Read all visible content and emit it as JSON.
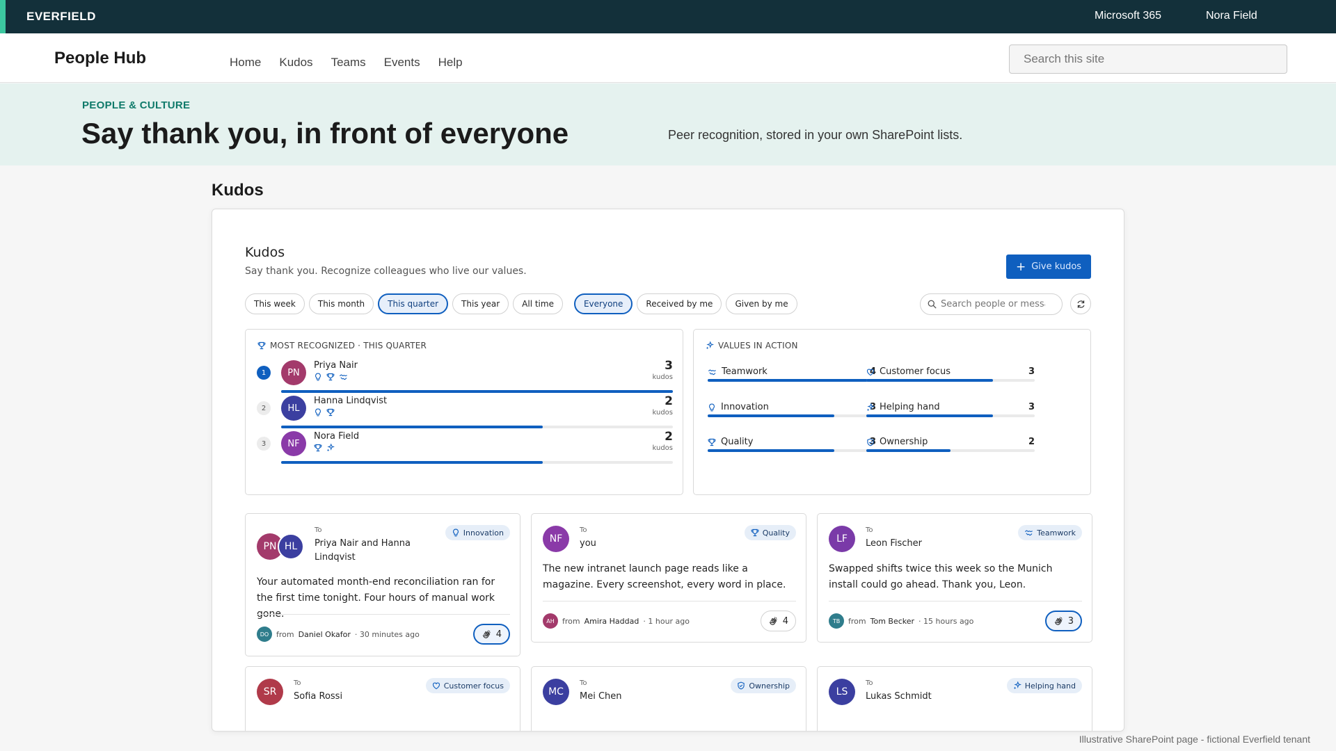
{
  "suitebar": {
    "brand": "EVERFIELD",
    "app": "Microsoft 365",
    "user": "Nora Field"
  },
  "site": {
    "title": "People Hub",
    "nav": [
      "Home",
      "Kudos",
      "Teams",
      "Events",
      "Help"
    ],
    "search_placeholder": "Search this site"
  },
  "hero": {
    "eyebrow": "PEOPLE & CULTURE",
    "headline": "Say thank you, in front of everyone",
    "subtitle": "Peer recognition, stored in your own SharePoint lists."
  },
  "section_title": "Kudos",
  "webpart": {
    "title": "Kudos",
    "subtitle": "Say thank you. Recognize colleagues who live our values.",
    "give_button": "Give kudos",
    "time_filters": [
      {
        "label": "This week",
        "active": false
      },
      {
        "label": "This month",
        "active": false
      },
      {
        "label": "This quarter",
        "active": true
      },
      {
        "label": "This year",
        "active": false
      },
      {
        "label": "All time",
        "active": false
      }
    ],
    "scope_filters": [
      {
        "label": "Everyone",
        "active": true
      },
      {
        "label": "Received by me",
        "active": false
      },
      {
        "label": "Given by me",
        "active": false
      }
    ],
    "search_placeholder": "Search people or messages",
    "leaderboard": {
      "heading": "MOST RECOGNIZED · THIS QUARTER",
      "unit": "kudos",
      "entries": [
        {
          "rank": "1",
          "initials": "PN",
          "name": "Priya Nair",
          "count": 3,
          "share": 1.0,
          "color": "#a33a6b",
          "icons": [
            "bulb-icon",
            "trophy-icon",
            "handshake-icon"
          ]
        },
        {
          "rank": "2",
          "initials": "HL",
          "name": "Hanna Lindqvist",
          "count": 2,
          "share": 0.667,
          "color": "#3b3fa0",
          "icons": [
            "bulb-icon",
            "trophy-icon"
          ]
        },
        {
          "rank": "3",
          "initials": "NF",
          "name": "Nora Field",
          "count": 2,
          "share": 0.667,
          "color": "#8a3aa8",
          "icons": [
            "trophy-icon",
            "sparkle-icon"
          ]
        }
      ]
    },
    "values": {
      "heading": "VALUES IN ACTION",
      "items": [
        {
          "label": "Teamwork",
          "count": 4,
          "share": 1.0,
          "icon": "handshake-icon"
        },
        {
          "label": "Customer focus",
          "count": 3,
          "share": 0.75,
          "icon": "heart-icon"
        },
        {
          "label": "Innovation",
          "count": 3,
          "share": 0.75,
          "icon": "bulb-icon"
        },
        {
          "label": "Helping hand",
          "count": 3,
          "share": 0.75,
          "icon": "sparkle-icon"
        },
        {
          "label": "Quality",
          "count": 3,
          "share": 0.75,
          "icon": "trophy-icon"
        },
        {
          "label": "Ownership",
          "count": 2,
          "share": 0.5,
          "icon": "shield-icon"
        }
      ]
    },
    "cards": [
      {
        "to_label": "To",
        "to": "Priya Nair and Hanna Lindqvist",
        "tag": "Innovation",
        "tag_icon": "bulb-icon",
        "message": "Your automated month-end reconciliation ran for the first time tonight. Four hours of manual work gone.",
        "from_label": "from",
        "from": "Daniel Okafor",
        "time": "· 30 minutes ago",
        "from_initials": "DO",
        "from_color": "#2f7d8c",
        "reactions": "4",
        "reacted": true
      },
      {
        "to_label": "To",
        "to": "you",
        "tag": "Quality",
        "tag_icon": "trophy-icon",
        "initials": "NF",
        "color": "#8a3aa8",
        "message": "The new intranet launch page reads like a magazine. Every screenshot, every word in place.",
        "from_label": "from",
        "from": "Amira Haddad",
        "time": "· 1 hour ago",
        "from_initials": "AH",
        "from_color": "#a33a6b",
        "reactions": "4",
        "reacted": false
      },
      {
        "to_label": "To",
        "to": "Leon Fischer",
        "tag": "Teamwork",
        "tag_icon": "handshake-icon",
        "initials": "LF",
        "color": "#7a3aa8",
        "message": "Swapped shifts twice this week so the Munich install could go ahead. Thank you, Leon.",
        "from_label": "from",
        "from": "Tom Becker",
        "time": "· 15 hours ago",
        "from_initials": "TB",
        "from_color": "#2f7d8c",
        "reactions": "3",
        "reacted": true
      },
      {
        "to_label": "To",
        "to": "Sofia Rossi",
        "tag": "Customer focus",
        "tag_icon": "heart-icon",
        "initials": "SR",
        "color": "#b03a4a"
      },
      {
        "to_label": "To",
        "to": "Mei Chen",
        "tag": "Ownership",
        "tag_icon": "shield-icon",
        "initials": "MC",
        "color": "#3b3fa0"
      },
      {
        "to_label": "To",
        "to": "Lukas Schmidt",
        "tag": "Helping hand",
        "tag_icon": "sparkle-icon",
        "initials": "LS",
        "color": "#3b3fa0"
      }
    ],
    "first_card_avatars": [
      {
        "initials": "PN",
        "color": "#a33a6b"
      },
      {
        "initials": "HL",
        "color": "#3b3fa0"
      }
    ]
  },
  "footnote": "Illustrative SharePoint page - fictional Everfield tenant"
}
